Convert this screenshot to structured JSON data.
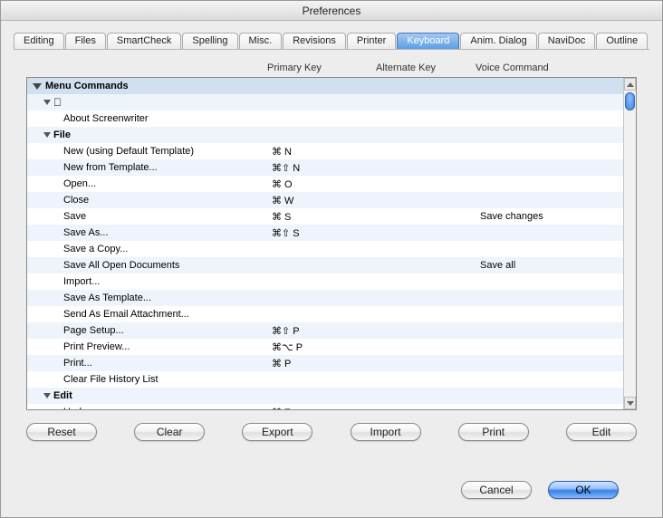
{
  "title": "Preferences",
  "tabs": [
    {
      "label": "Editing",
      "active": false
    },
    {
      "label": "Files",
      "active": false
    },
    {
      "label": "SmartCheck",
      "active": false
    },
    {
      "label": "Spelling",
      "active": false
    },
    {
      "label": "Misc.",
      "active": false
    },
    {
      "label": "Revisions",
      "active": false
    },
    {
      "label": "Printer",
      "active": false
    },
    {
      "label": "Keyboard",
      "active": true
    },
    {
      "label": "Anim. Dialog",
      "active": false
    },
    {
      "label": "NaviDoc",
      "active": false
    },
    {
      "label": "Outline",
      "active": false
    }
  ],
  "columns": {
    "primary": "Primary Key",
    "alternate": "Alternate Key",
    "voice": "Voice Command"
  },
  "tree_header": "Menu Commands",
  "rows": [
    {
      "indent": 18,
      "expander": true,
      "apple": true,
      "label": "",
      "primary": "",
      "alt": "",
      "voice": ""
    },
    {
      "indent": 40,
      "label": "About Screenwriter",
      "primary": "",
      "alt": "",
      "voice": ""
    },
    {
      "indent": 18,
      "expander": true,
      "label": "File",
      "bold": true,
      "primary": "",
      "alt": "",
      "voice": ""
    },
    {
      "indent": 40,
      "label": "New (using Default Template)",
      "primary": "⌘ N",
      "alt": "",
      "voice": ""
    },
    {
      "indent": 40,
      "label": "New from Template...",
      "primary": "⌘⇧ N",
      "alt": "",
      "voice": ""
    },
    {
      "indent": 40,
      "label": "Open...",
      "primary": "⌘ O",
      "alt": "",
      "voice": ""
    },
    {
      "indent": 40,
      "label": "Close",
      "primary": "⌘ W",
      "alt": "",
      "voice": ""
    },
    {
      "indent": 40,
      "label": "Save",
      "primary": "⌘ S",
      "alt": "",
      "voice": "Save changes"
    },
    {
      "indent": 40,
      "label": "Save As...",
      "primary": "⌘⇧ S",
      "alt": "",
      "voice": ""
    },
    {
      "indent": 40,
      "label": "Save a Copy...",
      "primary": "",
      "alt": "",
      "voice": ""
    },
    {
      "indent": 40,
      "label": "Save All Open Documents",
      "primary": "",
      "alt": "",
      "voice": "Save all"
    },
    {
      "indent": 40,
      "label": "Import...",
      "primary": "",
      "alt": "",
      "voice": ""
    },
    {
      "indent": 40,
      "label": "Save As Template...",
      "primary": "",
      "alt": "",
      "voice": ""
    },
    {
      "indent": 40,
      "label": "Send As Email Attachment...",
      "primary": "",
      "alt": "",
      "voice": ""
    },
    {
      "indent": 40,
      "label": "Page Setup...",
      "primary": "⌘⇧ P",
      "alt": "",
      "voice": ""
    },
    {
      "indent": 40,
      "label": "Print Preview...",
      "primary": "⌘⌥ P",
      "alt": "",
      "voice": ""
    },
    {
      "indent": 40,
      "label": "Print...",
      "primary": "⌘ P",
      "alt": "",
      "voice": ""
    },
    {
      "indent": 40,
      "label": "Clear File History List",
      "primary": "",
      "alt": "",
      "voice": ""
    },
    {
      "indent": 18,
      "expander": true,
      "label": "Edit",
      "bold": true,
      "primary": "",
      "alt": "",
      "voice": ""
    },
    {
      "indent": 40,
      "label": "Undo",
      "primary": "⌘ Z",
      "alt": "",
      "voice": ""
    }
  ],
  "actions": {
    "reset": "Reset",
    "clear": "Clear",
    "export": "Export",
    "import": "Import",
    "print": "Print",
    "edit": "Edit"
  },
  "footer": {
    "cancel": "Cancel",
    "ok": "OK"
  }
}
